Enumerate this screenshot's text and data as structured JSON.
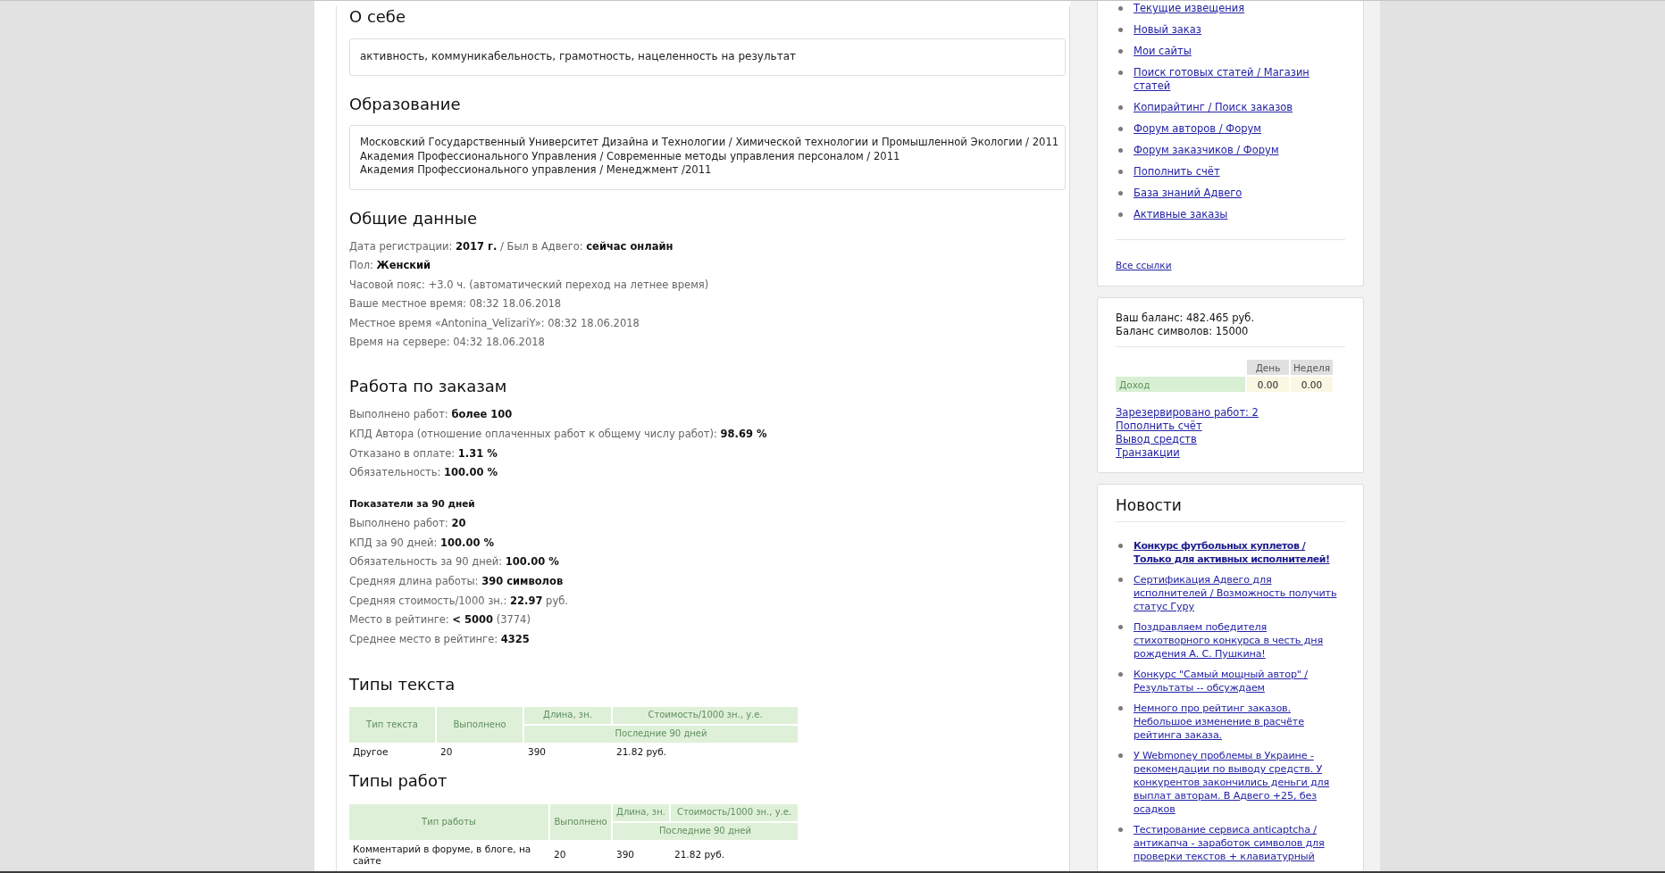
{
  "profile": {
    "about": {
      "title": "О себе",
      "text": "активность, коммуникабельность, грамотность, нацеленность на результат"
    },
    "education": {
      "title": "Образование",
      "lines": [
        "Московский Государственный Университет Дизайна и Технологии / Химической технологии и Промышленной Экологии / 2011",
        "Академия Профессионального Управления / Современные методы управления персоналом / 2011",
        "Академия Профессионального управления / Менеджмент /2011"
      ]
    },
    "general": {
      "title": "Общие данные",
      "lines": [
        "Дата регистрации: **2017 г.** / Был в Адвего: **сейчас онлайн**",
        "Пол: **Женский**",
        "Часовой пояс: +3.0 ч. (автоматический переход на летнее время)",
        "Ваше местное время: 08:32 18.06.2018",
        "Местное время «Antonina_VelizariY»: 08:32 18.06.2018",
        "Время на сервере: 04:32 18.06.2018"
      ]
    },
    "orders": {
      "title": "Работа по заказам",
      "lines": [
        "Выполнено работ: **более 100**",
        "КПД Автора (отношение оплаченных работ к общему числу работ): **98.69 %**",
        "Отказано в оплате: **1.31 %**",
        "Обязательность: **100.00 %**"
      ],
      "period": {
        "title": "Показатели за 90 дней",
        "lines": [
          "Выполнено работ: **20**",
          "КПД за 90 дней: **100.00 %**",
          "Обязательность за 90 дней: **100.00 %**",
          "Средняя длина работы: **390 символов**",
          "Средняя стоимость/1000 зн.: **22.97** руб.",
          "Место в рейтинге: **< 5000** (3774)",
          "Среднее место в рейтинге: **4325**"
        ]
      }
    },
    "text_types": {
      "title": "Типы текста",
      "table": {
        "columns": [
          "Тип текста",
          "Выполнено",
          "Длина, зн.",
          "Стоимость/1000 зн., у.е."
        ],
        "subheader": "Последние 90 дней",
        "rows": [
          [
            "Другое",
            "20",
            "390",
            "21.82 руб."
          ]
        ]
      }
    },
    "work_types": {
      "title": "Типы работ",
      "table": {
        "columns": [
          "Тип работы",
          "Выполнено",
          "Длина, зн.",
          "Стоимость/1000 зн., у.е."
        ],
        "subheader": "Последние 90 дней",
        "rows": [
          [
            "Комментарий в форуме, в блоге, на сайте",
            "20",
            "390",
            "21.82 руб."
          ]
        ]
      }
    }
  },
  "sidebar": {
    "links": [
      "Текущие извещения",
      "Новый заказ",
      "Мои сайты",
      "Поиск готовых статей / Магазин статей",
      "Копирайтинг / Поиск заказов",
      "Форум авторов / Форум",
      "Форум заказчиков / Форум",
      "Пополнить счёт",
      "База знаний Адвего",
      "Активные заказы"
    ],
    "all_links": "Все ссылки",
    "balance": {
      "lines": [
        "Ваш баланс: 482.465 руб.",
        "Баланс символов: 15000"
      ],
      "table": {
        "columns": [
          "День",
          "Неделя"
        ],
        "rows": [
          {
            "label": "Доход",
            "values": [
              "0.00",
              "0.00"
            ]
          }
        ]
      },
      "links": [
        "Зарезервировано работ: 2",
        "Пополнить счёт",
        "Вывод средств",
        "Транзакции"
      ]
    },
    "news": {
      "title": "Новости",
      "items": [
        {
          "text": "Конкурс футбольных куплетов / Только для активных исполнителей!",
          "emphasized": true
        },
        {
          "text": "Сертификация Адвего для исполнителей / Возможность получить статус Гуру",
          "emphasized": false
        },
        {
          "text": "Поздравляем победителя стихотворного конкурса в честь дня рождения А. С. Пушкина!",
          "emphasized": false
        },
        {
          "text": "Конкурс \"Самый мощный автор\" / Результаты -- обсуждаем",
          "emphasized": false
        },
        {
          "text": "Немного про рейтинг заказов. Небольшое изменение в расчёте рейтинга заказа.",
          "emphasized": false
        },
        {
          "text": "У Webmoney проблемы в Украине - рекомендации по выводу средств. У конкурентов закончились деньги для выплат авторам. В Адвего +25, без осадков",
          "emphasized": false
        },
        {
          "text": "Тестирование сервиса anticaptcha / антикапча - заработок символов для проверки текстов + клавиатурный",
          "emphasized": false
        }
      ]
    }
  }
}
